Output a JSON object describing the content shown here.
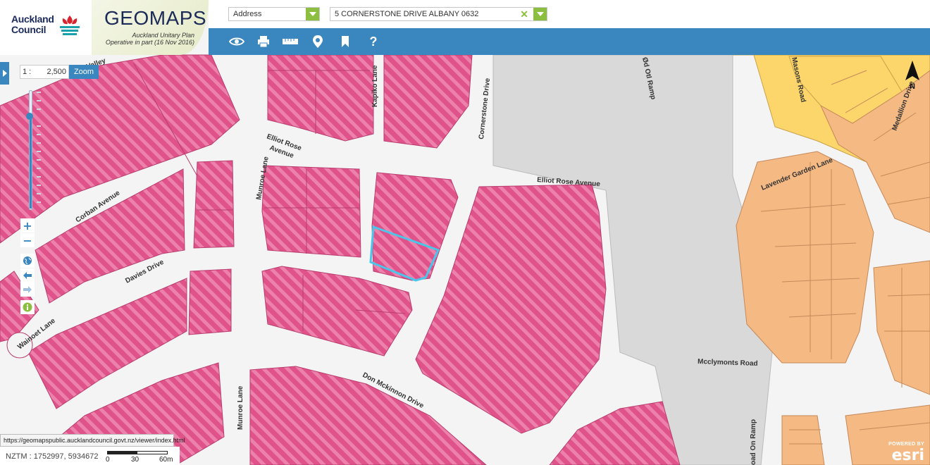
{
  "header": {
    "council_name_line1": "Auckland",
    "council_name_line2": "Council",
    "brand": "GEOMAPS",
    "subtitle_line1": "Auckland Unitary Plan",
    "subtitle_line2": "Operative in part (16 Nov 2016)"
  },
  "search": {
    "type_value": "Address",
    "address_value": "5 CORNERSTONE DRIVE ALBANY 0632"
  },
  "toolbar": {
    "icons": [
      "eye-icon",
      "print-icon",
      "ruler-icon",
      "map-pin-icon",
      "bookmark-icon",
      "help-icon"
    ],
    "help_label": "?"
  },
  "map_controls": {
    "scale_prefix": "1 :",
    "scale_value": "2,500",
    "zoom_button": "Zoom",
    "zoom_in": "+",
    "zoom_out": "−"
  },
  "map": {
    "roads": {
      "valley": "Valley",
      "kapiko": "Kapiko Lane",
      "cornerstone": "Cornerstone Drive",
      "otoff": "Ød Otl Ramp",
      "masons": "Masons Road",
      "medallion": "Medallion Drive",
      "elliot_rose_1": "Elliot Rose",
      "elliot_rose_2": "Avenue",
      "elliot_rose_avenue": "Elliot Rose Avenue",
      "munroe_1": "Munroe Lane",
      "munroe_2": "Munroe Lane",
      "corban": "Corban Avenue",
      "davies": "Davies Drive",
      "wainoet": "Wainoet Lane",
      "don_mckinnon": "Don Mckinnon Drive",
      "mcclymonts": "Mcclymonts Road",
      "on_ramp": "oad On Ramp",
      "lavender": "Lavender Garden Lane"
    },
    "colors": {
      "business_zone": "#e0528a",
      "stripe": "#ec82ab",
      "motorway": "#d9d9d9",
      "residential_orange": "#f5b983",
      "residential_yellow": "#fcd66a",
      "selected_parcel": "#49c6ea"
    }
  },
  "status": {
    "url": "https://geomapspublic.aucklandcouncil.govt.nz/viewer/index.html",
    "coords": "NZTM : 1752997, 5934672",
    "scale_labels": [
      "0",
      "30",
      "60m"
    ]
  },
  "attribution": {
    "powered_by": "POWERED BY",
    "esri": "esri"
  }
}
